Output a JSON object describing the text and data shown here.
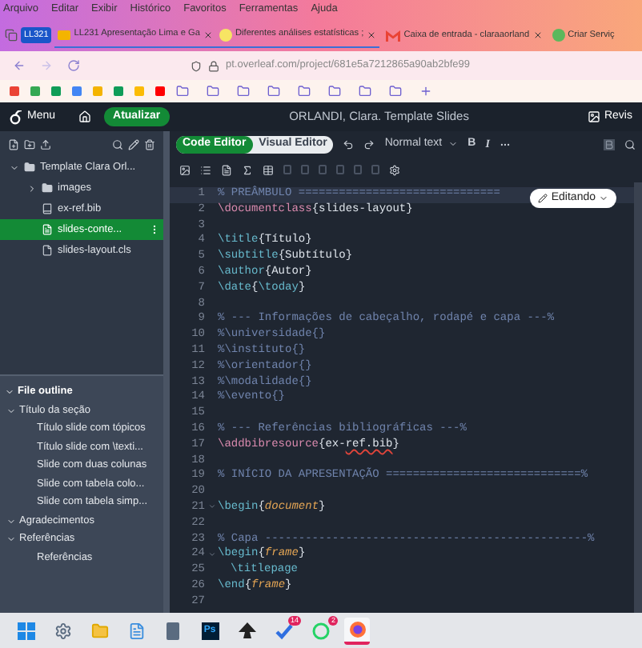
{
  "browser": {
    "menu": [
      "Arquivo",
      "Editar",
      "Exibir",
      "Histórico",
      "Favoritos",
      "Ferramentas",
      "Ajuda"
    ],
    "tab_group": {
      "label": "LL321",
      "tabs": [
        {
          "label": "LL231 Apresentação Lima e Ga",
          "kind": "slides"
        },
        {
          "label": "Diferentes análises estatísticas ;",
          "kind": "circle"
        }
      ]
    },
    "tabs": [
      {
        "label": "Caixa de entrada - claraaorland",
        "kind": "mail",
        "closable": true
      },
      {
        "label": "Criar Serviç",
        "kind": "green",
        "closable": false
      }
    ],
    "url": "pt.overleaf.com/project/681e5a7212865a90ab2bfe99"
  },
  "header": {
    "menu": "Menu",
    "recompile": "Atualizar",
    "title": "ORLANDI, Clara. Template Slides",
    "review": "Revis"
  },
  "file_tree": [
    {
      "name": "Template Clara Orl...",
      "kind": "folder",
      "expanded": true,
      "selected": false,
      "children": [
        {
          "name": "images",
          "kind": "folder",
          "expanded": false,
          "selected": false
        },
        {
          "name": "ex-ref.bib",
          "kind": "bib",
          "selected": false
        },
        {
          "name": "slides-conte...",
          "kind": "tex",
          "selected": true
        },
        {
          "name": "slides-layout.cls",
          "kind": "file",
          "selected": false
        }
      ]
    }
  ],
  "outline": {
    "title": "File outline",
    "expanded": true,
    "items": [
      {
        "label": "Título da seção",
        "expanded": true,
        "children": [
          {
            "label": "Título slide com tópicos"
          },
          {
            "label": "Título slide com \\texti..."
          },
          {
            "label": "Slide com duas colunas"
          },
          {
            "label": "Slide com tabela colo..."
          },
          {
            "label": "Slide com tabela simp..."
          }
        ]
      },
      {
        "label": "Agradecimentos",
        "expanded": true
      },
      {
        "label": "Referências",
        "expanded": true,
        "children": [
          {
            "label": "Referências"
          }
        ]
      }
    ]
  },
  "editor": {
    "modes": [
      {
        "label": "Code Editor",
        "selected": true
      },
      {
        "label": "Visual Editor",
        "selected": false
      }
    ],
    "text_style": "Normal text",
    "bold": "B",
    "italic": "I",
    "status": "Editando",
    "lines": [
      {
        "n": "1",
        "current": true,
        "fold": false,
        "tokens": [
          {
            "kind": "comment",
            "text": "% PREÂMBULO =============================="
          }
        ]
      },
      {
        "n": "2",
        "current": false,
        "fold": false,
        "tokens": [
          {
            "kind": "keyword",
            "text": "\\documentclass"
          },
          {
            "kind": "text",
            "text": "{slides-layout}"
          }
        ]
      },
      {
        "n": "3",
        "current": false,
        "fold": false
      },
      {
        "n": "4",
        "current": false,
        "fold": false,
        "tokens": [
          {
            "kind": "command",
            "text": "\\title"
          },
          {
            "kind": "text",
            "text": "{Título}"
          }
        ]
      },
      {
        "n": "5",
        "current": false,
        "fold": false,
        "tokens": [
          {
            "kind": "command",
            "text": "\\subtitle"
          },
          {
            "kind": "text",
            "text": "{Subtítulo}"
          }
        ]
      },
      {
        "n": "6",
        "current": false,
        "fold": false,
        "tokens": [
          {
            "kind": "command",
            "text": "\\author"
          },
          {
            "kind": "text",
            "text": "{Autor}"
          }
        ]
      },
      {
        "n": "7",
        "current": false,
        "fold": false,
        "tokens": [
          {
            "kind": "command",
            "text": "\\date"
          },
          {
            "kind": "text",
            "text": "{"
          },
          {
            "kind": "command",
            "text": "\\today"
          },
          {
            "kind": "text",
            "text": "}"
          }
        ]
      },
      {
        "n": "8",
        "current": false,
        "fold": false
      },
      {
        "n": "9",
        "current": false,
        "fold": false,
        "tokens": [
          {
            "kind": "comment",
            "text": "% --- Informações de cabeçalho, rodapé e capa ---%"
          }
        ]
      },
      {
        "n": "10",
        "current": false,
        "fold": false,
        "tokens": [
          {
            "kind": "comment",
            "text": "%\\universidade{}"
          }
        ]
      },
      {
        "n": "11",
        "current": false,
        "fold": false,
        "tokens": [
          {
            "kind": "comment",
            "text": "%\\instituto{}"
          }
        ]
      },
      {
        "n": "12",
        "current": false,
        "fold": false,
        "tokens": [
          {
            "kind": "comment",
            "text": "%\\orientador{}"
          }
        ]
      },
      {
        "n": "13",
        "current": false,
        "fold": false,
        "tokens": [
          {
            "kind": "comment",
            "text": "%\\modalidade{}"
          }
        ]
      },
      {
        "n": "14",
        "current": false,
        "fold": false,
        "tokens": [
          {
            "kind": "comment",
            "text": "%\\evento{}"
          }
        ]
      },
      {
        "n": "15",
        "current": false,
        "fold": false
      },
      {
        "n": "16",
        "current": false,
        "fold": false,
        "tokens": [
          {
            "kind": "comment",
            "text": "% --- Referências bibliográficas ---%"
          }
        ]
      },
      {
        "n": "17",
        "current": false,
        "fold": false,
        "tokens": [
          {
            "kind": "keyword",
            "text": "\\addbibresource"
          },
          {
            "kind": "text",
            "text": "{ex-"
          },
          {
            "kind": "misspelled",
            "text": "ref.bib"
          },
          {
            "kind": "text",
            "text": "}"
          }
        ]
      },
      {
        "n": "18",
        "current": false,
        "fold": false
      },
      {
        "n": "19",
        "current": false,
        "fold": false,
        "tokens": [
          {
            "kind": "comment",
            "text": "% INÍCIO DA APRESENTAÇÃO =============================%"
          }
        ]
      },
      {
        "n": "20",
        "current": false,
        "fold": false
      },
      {
        "n": "21",
        "current": false,
        "fold": true,
        "tokens": [
          {
            "kind": "command",
            "text": "\\begin"
          },
          {
            "kind": "text",
            "text": "{"
          },
          {
            "kind": "env",
            "text": "document"
          },
          {
            "kind": "text",
            "text": "}"
          }
        ]
      },
      {
        "n": "22",
        "current": false,
        "fold": false
      },
      {
        "n": "23",
        "current": false,
        "fold": false,
        "tokens": [
          {
            "kind": "comment",
            "text": "% Capa ------------------------------------------------%"
          }
        ]
      },
      {
        "n": "24",
        "current": false,
        "fold": true,
        "tokens": [
          {
            "kind": "command",
            "text": "\\begin"
          },
          {
            "kind": "text",
            "text": "{"
          },
          {
            "kind": "env",
            "text": "frame"
          },
          {
            "kind": "text",
            "text": "}"
          }
        ]
      },
      {
        "n": "25",
        "current": false,
        "fold": false,
        "indented": true,
        "tokens": [
          {
            "kind": "command",
            "text": "\\titlepage"
          }
        ]
      },
      {
        "n": "26",
        "current": false,
        "fold": false,
        "tokens": [
          {
            "kind": "command",
            "text": "\\end"
          },
          {
            "kind": "text",
            "text": "{"
          },
          {
            "kind": "env",
            "text": "frame"
          },
          {
            "kind": "text",
            "text": "}"
          }
        ]
      },
      {
        "n": "27",
        "current": false,
        "fold": false
      }
    ]
  },
  "taskbar": {
    "apps": [
      {
        "kind": "windows",
        "selected": false
      },
      {
        "kind": "settings",
        "selected": false
      },
      {
        "kind": "folder",
        "selected": false
      },
      {
        "kind": "notepad",
        "selected": false
      },
      {
        "kind": "calculator",
        "selected": false
      },
      {
        "kind": "ps",
        "label": "Ps",
        "selected": false
      },
      {
        "kind": "inkscape",
        "selected": false
      },
      {
        "kind": "todo",
        "badge": "14",
        "selected": false
      },
      {
        "kind": "whatsapp",
        "badge": "2",
        "selected": false
      },
      {
        "kind": "firefox",
        "selected": true
      }
    ]
  }
}
